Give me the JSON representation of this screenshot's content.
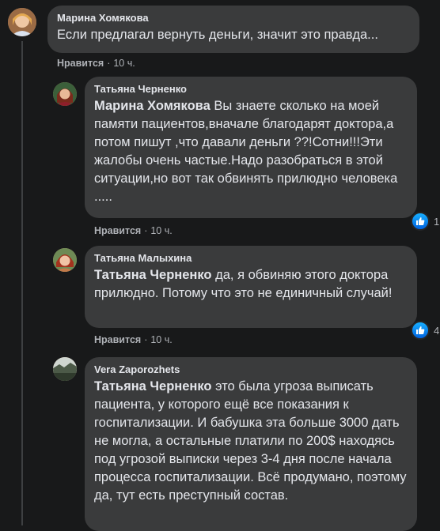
{
  "comments": [
    {
      "author": "Марина Хомякова",
      "mention": "",
      "text": "Если предлагал вернуть деньги, значит это правда...",
      "like_label": "Нравится",
      "time": "10 ч.",
      "reactions": ""
    },
    {
      "author": "Татьяна Черненко",
      "mention": "Марина Хомякова",
      "text": "Вы знаете сколько на моей памяти пациентов,вначале благодарят доктора,а потом пишут ,что давали деньги ??!Сотни!!!Эти жалобы очень частые.Надо разобраться в этой ситуации,но вот так обвинять прилюдно человека .....",
      "like_label": "Нравится",
      "time": "10 ч.",
      "reactions": "1"
    },
    {
      "author": "Татьяна Малыхина",
      "mention": "Татьяна Черненко",
      "text": "да, я обвиняю этого доктора прилюдно. Потому что это не единичный случай!",
      "like_label": "Нравится",
      "time": "10 ч.",
      "reactions": "4"
    },
    {
      "author": "Vera Zaporozhets",
      "mention": "Татьяна Черненко",
      "text": "это была угроза выписать пациента, у которого ещё все показания к госпитализации. И бабушка эта больше 3000 дать не могла, а остальные платили по 200$ находясь под угрозой выписки через 3-4 дня после начала процесса госпитализации. Всё продумано, поэтому да, тут есть преступный состав.",
      "like_label": "",
      "time": "",
      "reactions": ""
    }
  ],
  "colors": {
    "background": "#18191a",
    "bubble": "#3a3b3c",
    "text": "#e4e6eb",
    "secondary": "#b0b3b8",
    "like_blue": "#1877f2"
  },
  "icons": {
    "reaction": "like-thumb-icon"
  }
}
